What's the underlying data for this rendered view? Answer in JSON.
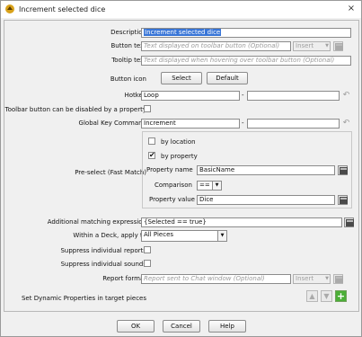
{
  "window": {
    "title": "Increment selected dice",
    "close_glyph": "×"
  },
  "form": {
    "description": {
      "label": "Description",
      "value": "Increment selected dice"
    },
    "button_text": {
      "label": "Button text",
      "placeholder": "Text displayed on toolbar button (Optional)",
      "insert_label": "Insert"
    },
    "tooltip_text": {
      "label": "Tooltip text",
      "placeholder": "Text displayed when hovering over toolbar button (Optional)"
    },
    "button_icon": {
      "label": "Button icon",
      "select_label": "Select",
      "default_label": "Default"
    },
    "hotkey": {
      "label": "Hotkey",
      "value": "Loop",
      "dash": "-"
    },
    "toolbar_disable": {
      "label": "Toolbar button can be disabled by a property"
    },
    "global_key": {
      "label": "Global Key Command",
      "value": "Increment",
      "dash": "-"
    },
    "preselect": {
      "label": "Pre-select (Fast Match)",
      "by_location": "by location",
      "by_property": "by property",
      "property_name_label": "Property name",
      "property_name_value": "BasicName",
      "comparison_label": "Comparison",
      "comparison_value": "==",
      "property_value_label": "Property value",
      "property_value_value": "Dice"
    },
    "additional": {
      "label": "Additional matching expression",
      "value": "{Selected == true}"
    },
    "within_deck": {
      "label": "Within a Deck, apply to",
      "value": "All Pieces"
    },
    "suppress_reports": {
      "label": "Suppress individual reports"
    },
    "suppress_sounds": {
      "label": "Suppress individual sounds"
    },
    "report_format": {
      "label": "Report format",
      "placeholder": "Report sent to Chat window (Optional)",
      "insert_label": "Insert"
    },
    "dynamic_props": {
      "label": "Set Dynamic Properties in target pieces"
    }
  },
  "footer": {
    "ok": "OK",
    "cancel": "Cancel",
    "help": "Help"
  }
}
